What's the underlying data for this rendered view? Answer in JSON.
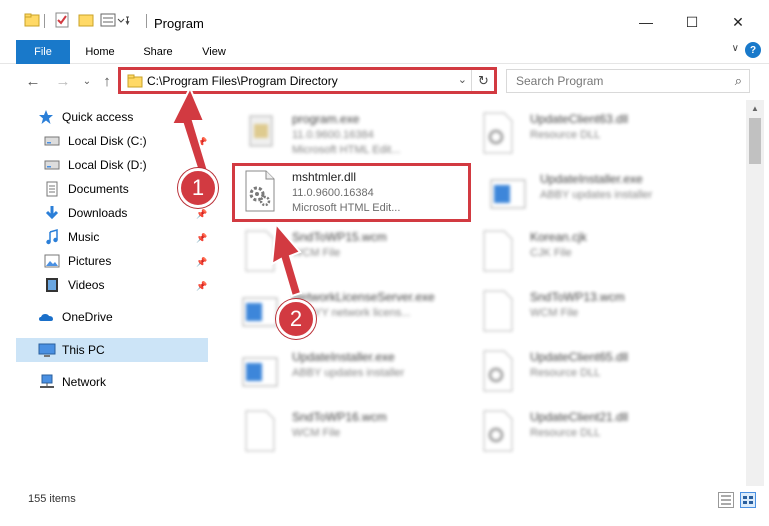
{
  "window": {
    "title": "Program",
    "minimize_glyph": "—",
    "maximize_glyph": "☐",
    "close_glyph": "✕"
  },
  "ribbon": {
    "tabs": [
      "File",
      "Home",
      "Share",
      "View"
    ],
    "help_glyph": "?",
    "collapse_glyph": "∨"
  },
  "nav": {
    "back_glyph": "←",
    "forward_glyph": "→",
    "recent_glyph": "⌄",
    "up_glyph": "↑",
    "address": "C:\\Program Files\\Program Directory",
    "address_dropdown_glyph": "⌄",
    "refresh_glyph": "↻",
    "search_placeholder": "Search Program",
    "search_glyph": "⌕"
  },
  "sidebar": {
    "quick_access": "Quick access",
    "items": [
      {
        "label": "Local Disk (C:)",
        "icon": "drive-icon"
      },
      {
        "label": "Local Disk (D:)",
        "icon": "drive-icon"
      },
      {
        "label": "Documents",
        "icon": "documents-icon"
      },
      {
        "label": "Downloads",
        "icon": "downloads-icon"
      },
      {
        "label": "Music",
        "icon": "music-icon"
      },
      {
        "label": "Pictures",
        "icon": "pictures-icon"
      },
      {
        "label": "Videos",
        "icon": "videos-icon"
      }
    ],
    "onedrive": "OneDrive",
    "thispc": "This PC",
    "network": "Network"
  },
  "files": {
    "left": [
      {
        "name": "program.exe",
        "line2": "11.0.9600.16384",
        "line3": "Microsoft HTML Edit...",
        "icon": "exe-icon"
      },
      {
        "name": "mshtmler.dll",
        "line2": "11.0.9600.16384",
        "line3": "Microsoft HTML Edit...",
        "icon": "dll-gear-icon"
      },
      {
        "name": "SndToWP15.wcm",
        "line2": "WCM File",
        "line3": "",
        "icon": "blank-file-icon"
      },
      {
        "name": "NetworkLicenseServer.exe",
        "line2": "ABBYY network licens...",
        "line3": "",
        "icon": "app-window-icon"
      },
      {
        "name": "UpdateInstaller.exe",
        "line2": "ABBY updates installer",
        "line3": "",
        "icon": "app-window-icon"
      },
      {
        "name": "SndToWP16.wcm",
        "line2": "WCM File",
        "line3": "",
        "icon": "blank-file-icon"
      }
    ],
    "right": [
      {
        "name": "UpdateClient63.dll",
        "line2": "Resource DLL",
        "icon": "dll-gear-icon"
      },
      {
        "name": "UpdateInstaller.exe",
        "line2": "ABBY updates installer",
        "icon": "app-window-icon"
      },
      {
        "name": "Korean.cjk",
        "line2": "CJK File",
        "icon": "blank-file-icon"
      },
      {
        "name": "SndToWP13.wcm",
        "line2": "WCM File",
        "icon": "blank-file-icon"
      },
      {
        "name": "UpdateClient65.dll",
        "line2": "Resource DLL",
        "icon": "dll-gear-icon"
      },
      {
        "name": "UpdateClient21.dll",
        "line2": "Resource DLL",
        "icon": "dll-gear-icon"
      }
    ]
  },
  "status": {
    "item_count": "155 items"
  },
  "callouts": [
    "1",
    "2"
  ],
  "colors": {
    "accent": "#1979ca",
    "highlight": "#d23a41",
    "selected": "#cce4f7"
  }
}
